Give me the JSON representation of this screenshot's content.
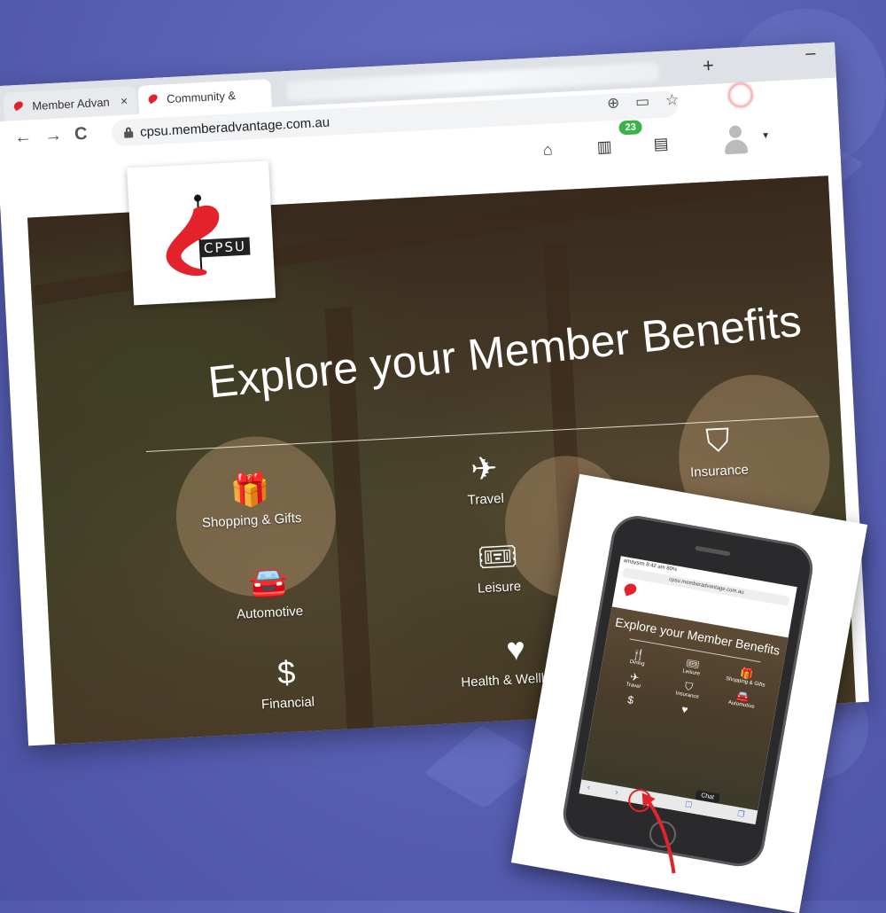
{
  "tabs": [
    {
      "label": "Member Advan",
      "close": "×"
    },
    {
      "label": "Community & "
    }
  ],
  "window": {
    "new_tab": "+",
    "minimize": "–"
  },
  "toolbar": {
    "back": "←",
    "forward": "→",
    "reload": "C",
    "url": "cpsu.memberadvantage.com.au",
    "icons": [
      "location-icon",
      "cast-icon",
      "star-icon"
    ]
  },
  "header": {
    "home_icon": "⌂",
    "map_badge": "23",
    "map_icon": "▥",
    "card_icon": "▤"
  },
  "logo": {
    "text": "CPSU"
  },
  "hero": {
    "title": "Explore your Member Benefits"
  },
  "categories": [
    {
      "label": "Shopping & Gifts",
      "icon": "gift-icon",
      "glyph": "🎁"
    },
    {
      "label": "Travel",
      "icon": "plane-icon",
      "glyph": "✈"
    },
    {
      "label": "Insurance",
      "icon": "shield-icon",
      "glyph": "⛉"
    },
    {
      "label": "Automotive",
      "icon": "car-icon",
      "glyph": "🚘"
    },
    {
      "label": "Leisure",
      "icon": "ticket-icon",
      "glyph": "🎟"
    },
    {
      "label": "Financial",
      "icon": "dollar-icon",
      "glyph": "$"
    },
    {
      "label": "Health & Wellbeing",
      "icon": "heart-icon",
      "glyph": "♥"
    },
    {
      "label": "Dining",
      "icon": "cutlery-icon",
      "glyph": "🍴"
    }
  ],
  "mobile": {
    "status": "amaysim  8:42 am  80%",
    "url": "cpsu.memberadvantage.com.au",
    "title": "Explore your Member Benefits",
    "items": [
      {
        "label": "Dining",
        "glyph": "🍴"
      },
      {
        "label": "Leisure",
        "glyph": "🎟"
      },
      {
        "label": "Shopping & Gifts",
        "glyph": "🎁"
      },
      {
        "label": "Travel",
        "glyph": "✈"
      },
      {
        "label": "Insurance",
        "glyph": "⛉"
      },
      {
        "label": "Automotive",
        "glyph": "🚘"
      },
      {
        "label": "",
        "glyph": "$"
      },
      {
        "label": "",
        "glyph": "♥"
      },
      {
        "label": "",
        "glyph": ""
      }
    ],
    "chat": "Chat"
  },
  "colors": {
    "brand_red": "#e4222c",
    "badge_green": "#3cb24a",
    "background": "#5a62b6"
  }
}
